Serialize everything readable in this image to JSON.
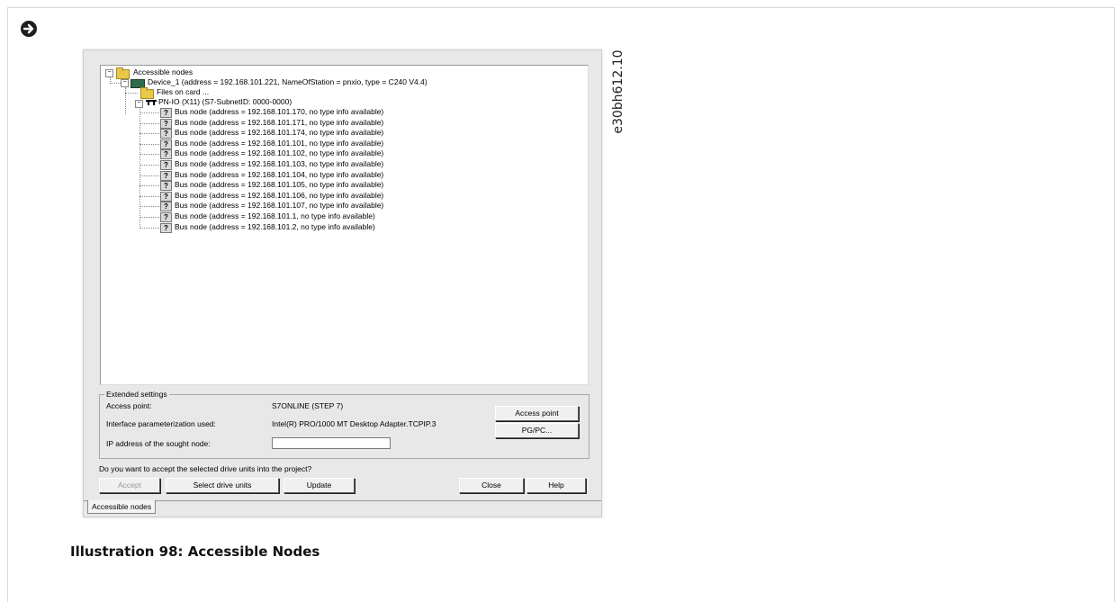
{
  "side_label": "e30bh612.10",
  "caption": "Illustration 98: Accessible Nodes",
  "tree": {
    "root": "Accessible nodes",
    "device": "Device_1 (address = 192.168.101.221, NameOfStation = pnxio, type = C240 V4.4)",
    "files": "Files on card ...",
    "pnio": "PN-IO (X11) (S7-SubnetID: 0000-0000)",
    "bus_nodes": [
      "Bus node (address = 192.168.101.170, no type info available)",
      "Bus node (address = 192.168.101.171, no type info available)",
      "Bus node (address = 192.168.101.174, no type info available)",
      "Bus node (address = 192.168.101.101, no type info available)",
      "Bus node (address = 192.168.101.102, no type info available)",
      "Bus node (address = 192.168.101.103, no type info available)",
      "Bus node (address = 192.168.101.104, no type info available)",
      "Bus node (address = 192.168.101.105, no type info available)",
      "Bus node (address = 192.168.101.106, no type info available)",
      "Bus node (address = 192.168.101.107, no type info available)",
      "Bus node (address = 192.168.101.1, no type info available)",
      "Bus node (address = 192.168.101.2, no type info available)"
    ]
  },
  "extended": {
    "title": "Extended settings",
    "access_point_label": "Access point:",
    "access_point_value": "S7ONLINE (STEP 7)",
    "interface_label": "Interface parameterization used:",
    "interface_value": "Intel(R) PRO/1000 MT Desktop Adapter.TCPIP.3",
    "ip_label": "IP address of the sought node:",
    "ip_value": "",
    "access_point_button": "Access point",
    "pgpc_button": "PG/PC..."
  },
  "question": "Do you want to accept the selected drive units into the project?",
  "buttons": {
    "accept": "Accept",
    "select": "Select drive units",
    "update": "Update",
    "close": "Close",
    "help": "Help"
  },
  "tab": "Accessible nodes"
}
